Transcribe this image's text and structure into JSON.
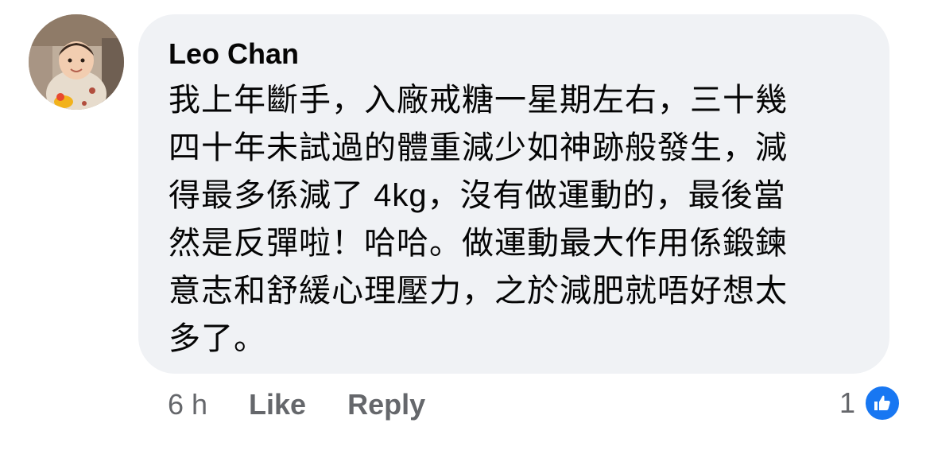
{
  "comment": {
    "author": "Leo Chan",
    "lines": [
      "我上年斷手，入廠戒糖一星期左右，三十幾",
      "四十年未試過的體重減少如神跡般發生，減",
      "得最多係減了 4kg，沒有做運動的，最後當",
      "然是反彈啦！哈哈。做運動最大作用係鍛鍊",
      "意志和舒緩心理壓力，之於減肥就唔好想太",
      "多了。"
    ]
  },
  "actions": {
    "time": "6 h",
    "like_label": "Like",
    "reply_label": "Reply"
  },
  "reactions": {
    "count": "1",
    "icon": "thumbs-up-icon",
    "color": "#1877f2"
  },
  "colors": {
    "bubble": "#f0f2f5",
    "text": "#050505",
    "secondary": "#65676b"
  }
}
